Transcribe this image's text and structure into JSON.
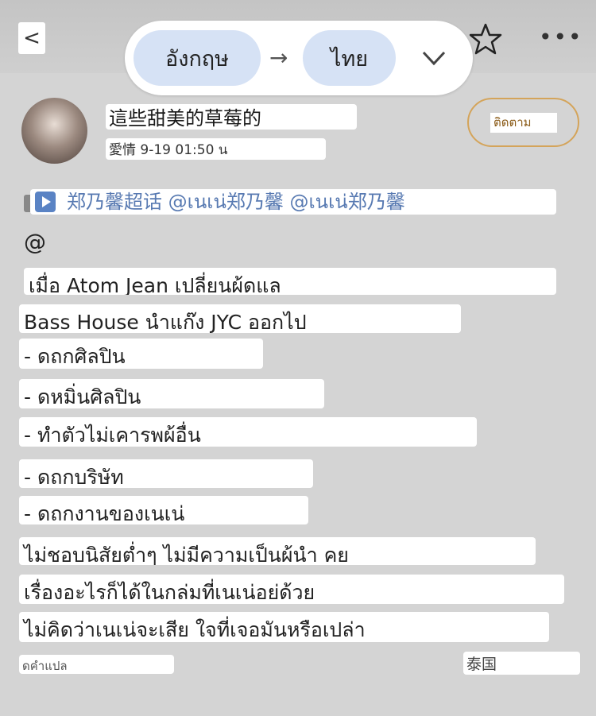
{
  "nav": {
    "back_label": "<",
    "source_lang": "อังกฤษ",
    "arrow": "→",
    "target_lang": "ไทย",
    "more_label": "•••"
  },
  "post": {
    "username": "這些甜美的草莓的",
    "meta": "愛情 9-19 01:50 น",
    "follow_label": "ติดตาม",
    "topic": "郑乃馨超话 @เนเน่郑乃馨 @เนเน่郑乃馨",
    "at": "@",
    "lines": [
      "เมื่อ Atom Jean เปลี่ยนผ้ดแล",
      "Bass House นำแก๊ง JYC ออกไป",
      "- ดถกศิลปิน",
      "- ดหมิ่นศิลปิน",
      "- ทำตัวไม่เคารพผ้อื่น",
      "- ดถกบริษัท",
      "- ดถกงานของเนเน่",
      "ไม่ชอบนิสัยต่ำๆ ไม่มีความเป็นผ้นำ คย",
      "เรื่องอะไรก็ได้ในกล่มที่เนเน่อย่ด้วย",
      "ไม่คิดว่าเนเน่จะเสีย ใจที่เจอมันหรือเปล่า"
    ]
  },
  "footer": {
    "translate_label": "ดคำแปล",
    "location": "泰国"
  },
  "colors": {
    "background": "#d4d4d4",
    "lang_chip": "#d6e2f5",
    "follow_border": "#d4a45a",
    "topic_text": "#587ab2"
  },
  "icons": [
    "back-icon",
    "arrow-right-icon",
    "chevron-down-icon",
    "star-icon",
    "more-icon",
    "play-icon",
    "avatar"
  ]
}
